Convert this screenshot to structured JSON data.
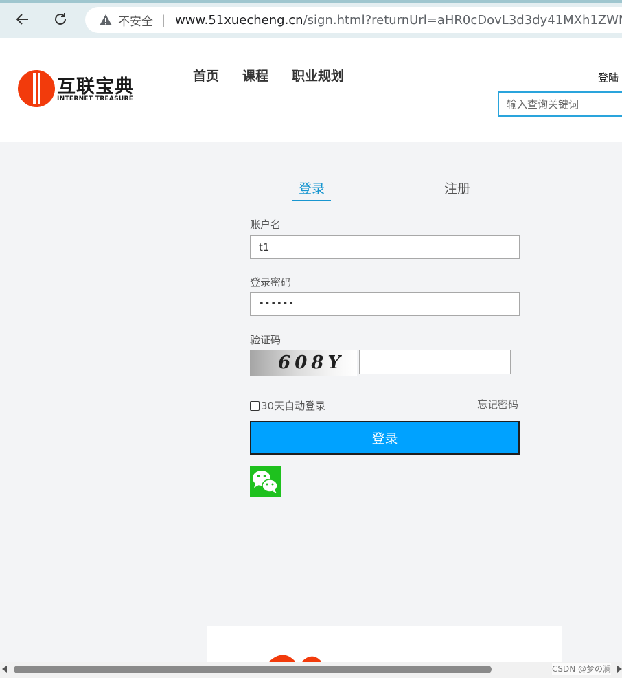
{
  "browser": {
    "insecure_label": "不安全",
    "separator": "|",
    "url_host": "www.51xuecheng.cn",
    "url_path": "/sign.html?returnUrl=aHR0cDovL3d3dy41MXh1ZWNoZW5nLmN"
  },
  "header": {
    "logo_cn": "互联宝典",
    "logo_en": "INTERNET TREASURE",
    "nav": [
      "首页",
      "课程",
      "职业规划"
    ],
    "login_link": "登陆",
    "search_placeholder": "输入查询关键词"
  },
  "form": {
    "tab_login": "登录",
    "tab_register": "注册",
    "username_label": "账户名",
    "username_value": "t1",
    "password_label": "登录密码",
    "password_value": "••••••",
    "captcha_label": "验证码",
    "captcha_text": "608Y",
    "remember_label": "30天自动登录",
    "forgot_label": "忘记密码",
    "submit_label": "登录"
  },
  "watermark": "CSDN @梦の澜",
  "colors": {
    "accent": "#00a2ff",
    "tab_active": "#1896d0",
    "logo_red": "#f23b0c",
    "wechat_green": "#1ec11e"
  }
}
